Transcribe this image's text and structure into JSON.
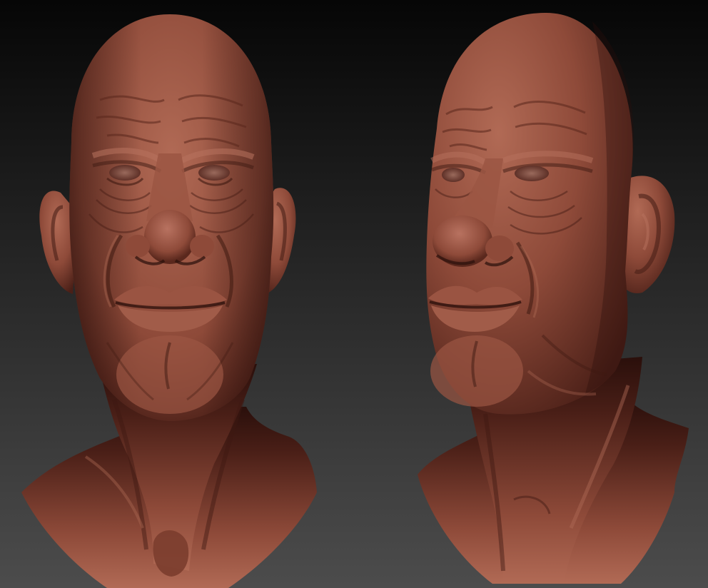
{
  "scene": {
    "background_top": "#060606",
    "background_bottom": "#4c4c4c",
    "clay_light": "#b16a55",
    "clay_mid": "#8e4a39",
    "clay_dark": "#4a1f17",
    "clay_shadow": "#2a0f0b"
  },
  "views": [
    {
      "name": "front-view"
    },
    {
      "name": "three-quarter-view"
    }
  ]
}
